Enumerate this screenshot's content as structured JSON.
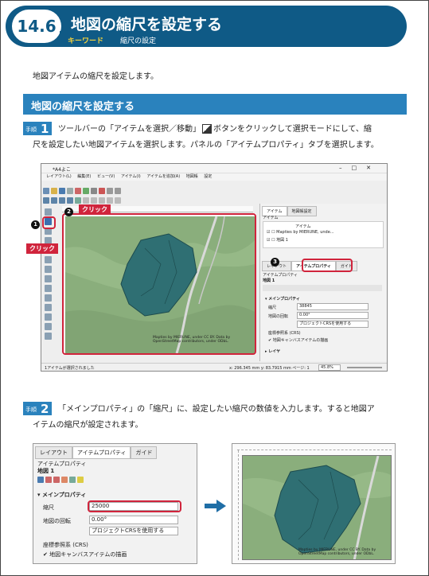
{
  "header": {
    "number": "14.6",
    "title": "地図の縮尺を設定する",
    "keyword_label": "キーワード",
    "keyword_value": "縮尺の設定"
  },
  "intro": "地図アイテムの縮尺を設定します。",
  "section_title": "地図の縮尺を設定する",
  "steps": [
    {
      "label": "手順",
      "number": "1",
      "text_line1": "ツールバーの「アイテムを選択／移動」",
      "text_line1b": "ボタンをクリックして選択モードにして、縮",
      "text_line2": "尺を設定したい地図アイテムを選択します。パネルの「アイテムプロパティ」タブを選択します。"
    },
    {
      "label": "手順",
      "number": "2",
      "text_line1": "「メインプロパティ」の「縮尺」に、設定したい縮尺の数値を入力します。すると地図ア",
      "text_line2": "イテムの縮尺が設定されます。"
    }
  ],
  "qgis": {
    "window_title": "*A4よこ",
    "menu": [
      "レイアウト(L)",
      "編集(E)",
      "ビュー(V)",
      "アイテム(I)",
      "アイテムを追加(A)",
      "地図帳",
      "設定"
    ],
    "click_label": "クリック",
    "badges": [
      "1",
      "2",
      "3"
    ],
    "panel_tabs": [
      "アイテム",
      "地図帳設定"
    ],
    "items_header": "アイテム",
    "items_col": "アイテム",
    "items": [
      "Mapties by MIERUNE, unde...",
      "地図 1"
    ],
    "prop_tabs": [
      "レイアウト",
      "アイテムプロパティ",
      "ガイド"
    ],
    "prop_title": "アイテムプロパティ",
    "prop_map": "地図 1",
    "main_props": "メインプロパティ",
    "scale_label": "縮尺",
    "scale_value": "38845",
    "rotation_label": "地図の回転",
    "rotation_value": "0.00°",
    "crs_label": "座標参照系 (CRS)",
    "crs_select": "プロジェクトCRSを使用する",
    "canvas_checkbox": "地図キャンバスアイテムの描画",
    "layers": "レイヤ",
    "attribution": "Mapties by MIERUNE, under CC BY. Data by OpenStreetMap contributors, under ODbL.",
    "status_left": "1アイテムが選択されました",
    "status_right": "x: 296.345 mm y: 83.7915 mm ページ: 1",
    "zoom": "45.8%"
  },
  "panel2": {
    "tabs": [
      "レイアウト",
      "アイテムプロパティ",
      "ガイド"
    ],
    "title": "アイテムプロパティ",
    "map": "地図 1",
    "main_props": "メインプロパティ",
    "scale_label": "縮尺",
    "scale_value": "25000",
    "rotation_label": "地図の回転",
    "rotation_value": "0.00°",
    "crs_select": "プロジェクトCRSを使用する",
    "crs_label": "座標参照系 (CRS)",
    "canvas_checkbox": "地図キャンバスアイテムの描画"
  },
  "colors": {
    "header": "#0f5a86",
    "section": "#2a82bd",
    "highlight": "#d0243c",
    "map_green": "#8aae7c",
    "polygon": "#2f6f73"
  }
}
